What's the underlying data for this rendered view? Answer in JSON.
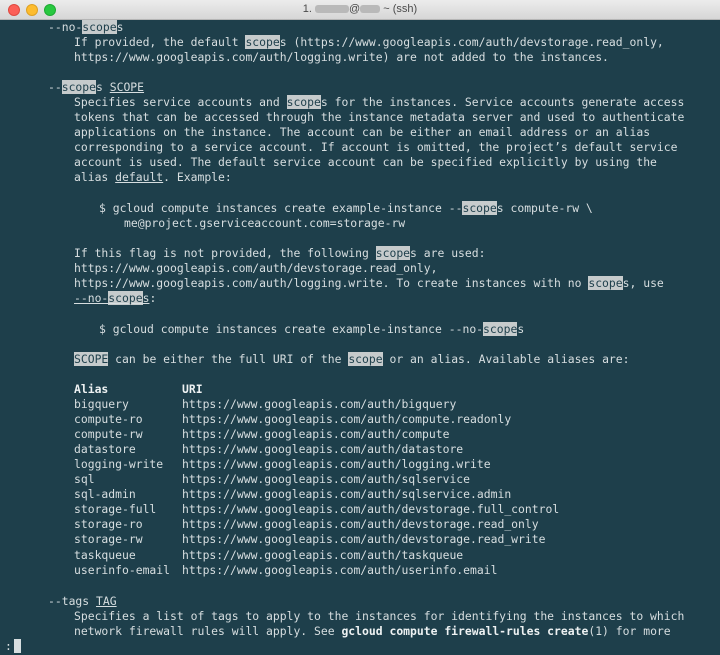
{
  "window": {
    "title_prefix": "1.",
    "title_at": "@",
    "title_suffix": "~ (ssh)"
  },
  "terminal": {
    "no_scopes_flag_a": "--no-",
    "no_scopes_flag_b": "scope",
    "no_scopes_flag_c": "s",
    "no_scopes_desc1_a": "If provided, the default ",
    "no_scopes_desc1_b": "scope",
    "no_scopes_desc1_c": "s (https://www.googleapis.com/auth/devstorage.read_only,",
    "no_scopes_desc2": "https://www.googleapis.com/auth/logging.write) are not added to the instances.",
    "scopes_flag_a": "--",
    "scopes_flag_b": "scope",
    "scopes_flag_c": "s ",
    "scopes_flag_arg": "SCOPE",
    "scopes_desc1_a": "Specifies service accounts and ",
    "scopes_desc1_b": "scope",
    "scopes_desc1_c": "s for the instances. Service accounts generate access",
    "scopes_desc2": "tokens that can be accessed through the instance metadata server and used to authenticate",
    "scopes_desc3": "applications on the instance. The account can be either an email address or an alias",
    "scopes_desc4": "corresponding to a service account. If account is omitted, the project’s default service",
    "scopes_desc5": "account is used. The default service account can be specified explicitly by using the",
    "scopes_desc6_a": "alias ",
    "scopes_desc6_b": "default",
    "scopes_desc6_c": ". Example:",
    "example1_a": "$ gcloud compute instances create example-instance --",
    "example1_b": "scope",
    "example1_c": "s compute-rw \\",
    "example1_line2": "me@project.gserviceaccount.com=storage-rw",
    "notprov1_a": "If this flag is not provided, the following ",
    "notprov1_b": "scope",
    "notprov1_c": "s are used:",
    "notprov2": "https://www.googleapis.com/auth/devstorage.read_only,",
    "notprov3_a": "https://www.googleapis.com/auth/logging.write. To create instances with no ",
    "notprov3_b": "scope",
    "notprov3_c": "s, use",
    "notprov4_a": "--no-",
    "notprov4_b": "scope",
    "notprov4_c": "s",
    "notprov4_d": ":",
    "example2_a": "$ gcloud compute instances create example-instance --no-",
    "example2_b": "scope",
    "example2_c": "s",
    "scope_line_a": "SCOPE",
    "scope_line_b": " can be either the full URI of the ",
    "scope_line_c": "scope",
    "scope_line_d": " or an alias. Available aliases are:",
    "alias_header": "Alias",
    "uri_header": "URI",
    "aliases": [
      {
        "alias": "bigquery",
        "uri": "https://www.googleapis.com/auth/bigquery"
      },
      {
        "alias": "compute-ro",
        "uri": "https://www.googleapis.com/auth/compute.readonly"
      },
      {
        "alias": "compute-rw",
        "uri": "https://www.googleapis.com/auth/compute"
      },
      {
        "alias": "datastore",
        "uri": "https://www.googleapis.com/auth/datastore"
      },
      {
        "alias": "logging-write",
        "uri": "https://www.googleapis.com/auth/logging.write"
      },
      {
        "alias": "sql",
        "uri": "https://www.googleapis.com/auth/sqlservice"
      },
      {
        "alias": "sql-admin",
        "uri": "https://www.googleapis.com/auth/sqlservice.admin"
      },
      {
        "alias": "storage-full",
        "uri": "https://www.googleapis.com/auth/devstorage.full_control"
      },
      {
        "alias": "storage-ro",
        "uri": "https://www.googleapis.com/auth/devstorage.read_only"
      },
      {
        "alias": "storage-rw",
        "uri": "https://www.googleapis.com/auth/devstorage.read_write"
      },
      {
        "alias": "taskqueue",
        "uri": "https://www.googleapis.com/auth/taskqueue"
      },
      {
        "alias": "userinfo-email",
        "uri": "https://www.googleapis.com/auth/userinfo.email"
      }
    ],
    "tags_flag": "--tags ",
    "tags_arg": "TAG",
    "tags_desc1": "Specifies a list of tags to apply to the instances for identifying the instances to which",
    "tags_desc2_a": "network firewall rules will apply. See ",
    "tags_desc2_b": "gcloud compute firewall-rules create",
    "tags_desc2_c": "(1) for more",
    "prompt": ":"
  },
  "colors": {
    "background": "#1e3f4b",
    "text": "#d7dee0",
    "highlight": "#c6cbcc"
  }
}
